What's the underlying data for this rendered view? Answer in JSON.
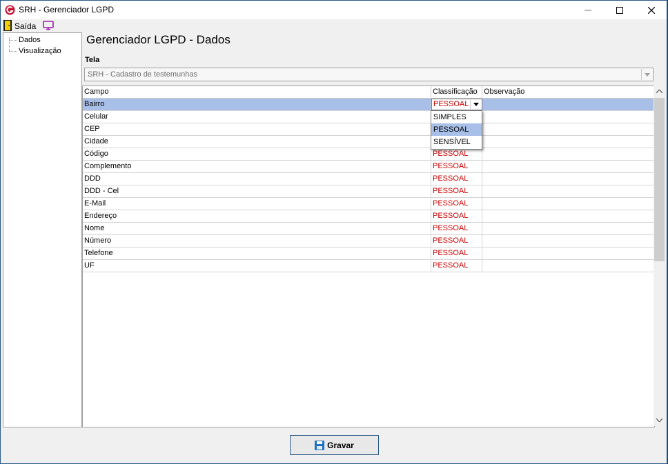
{
  "window": {
    "title": "SRH - Gerenciador LGPD"
  },
  "menubar": {
    "exit_label": "Saída"
  },
  "tree": {
    "items": [
      {
        "label": "Dados"
      },
      {
        "label": "Visualização"
      }
    ]
  },
  "main": {
    "page_title": "Gerenciador LGPD - Dados",
    "tela_label": "Tela",
    "tela_value": "SRH - Cadastro de testemunhas"
  },
  "grid": {
    "columns": [
      "Campo",
      "Classificação",
      "Observação"
    ],
    "rows": [
      {
        "campo": "Bairro",
        "classificacao": "PESSOAL",
        "observacao": ""
      },
      {
        "campo": "Celular",
        "classificacao": "",
        "observacao": ""
      },
      {
        "campo": "CEP",
        "classificacao": "",
        "observacao": ""
      },
      {
        "campo": "Cidade",
        "classificacao": "",
        "observacao": ""
      },
      {
        "campo": "Código",
        "classificacao": "PESSOAL",
        "observacao": ""
      },
      {
        "campo": "Complemento",
        "classificacao": "PESSOAL",
        "observacao": ""
      },
      {
        "campo": "DDD",
        "classificacao": "PESSOAL",
        "observacao": ""
      },
      {
        "campo": "DDD - Cel",
        "classificacao": "PESSOAL",
        "observacao": ""
      },
      {
        "campo": "E-Mail",
        "classificacao": "PESSOAL",
        "observacao": ""
      },
      {
        "campo": "Endereço",
        "classificacao": "PESSOAL",
        "observacao": ""
      },
      {
        "campo": "Nome",
        "classificacao": "PESSOAL",
        "observacao": ""
      },
      {
        "campo": "Número",
        "classificacao": "PESSOAL",
        "observacao": ""
      },
      {
        "campo": "Telefone",
        "classificacao": "PESSOAL",
        "observacao": ""
      },
      {
        "campo": "UF",
        "classificacao": "PESSOAL",
        "observacao": ""
      }
    ],
    "dropdown_options": [
      "SIMPLES",
      "PESSOAL",
      "SENSÍVEL"
    ],
    "dropdown_selected": "PESSOAL"
  },
  "footer": {
    "save_label": "Gravar"
  },
  "colors": {
    "accent": "#2b5a87",
    "selection": "#a8bfe8",
    "classification_text": "#cc0000"
  }
}
